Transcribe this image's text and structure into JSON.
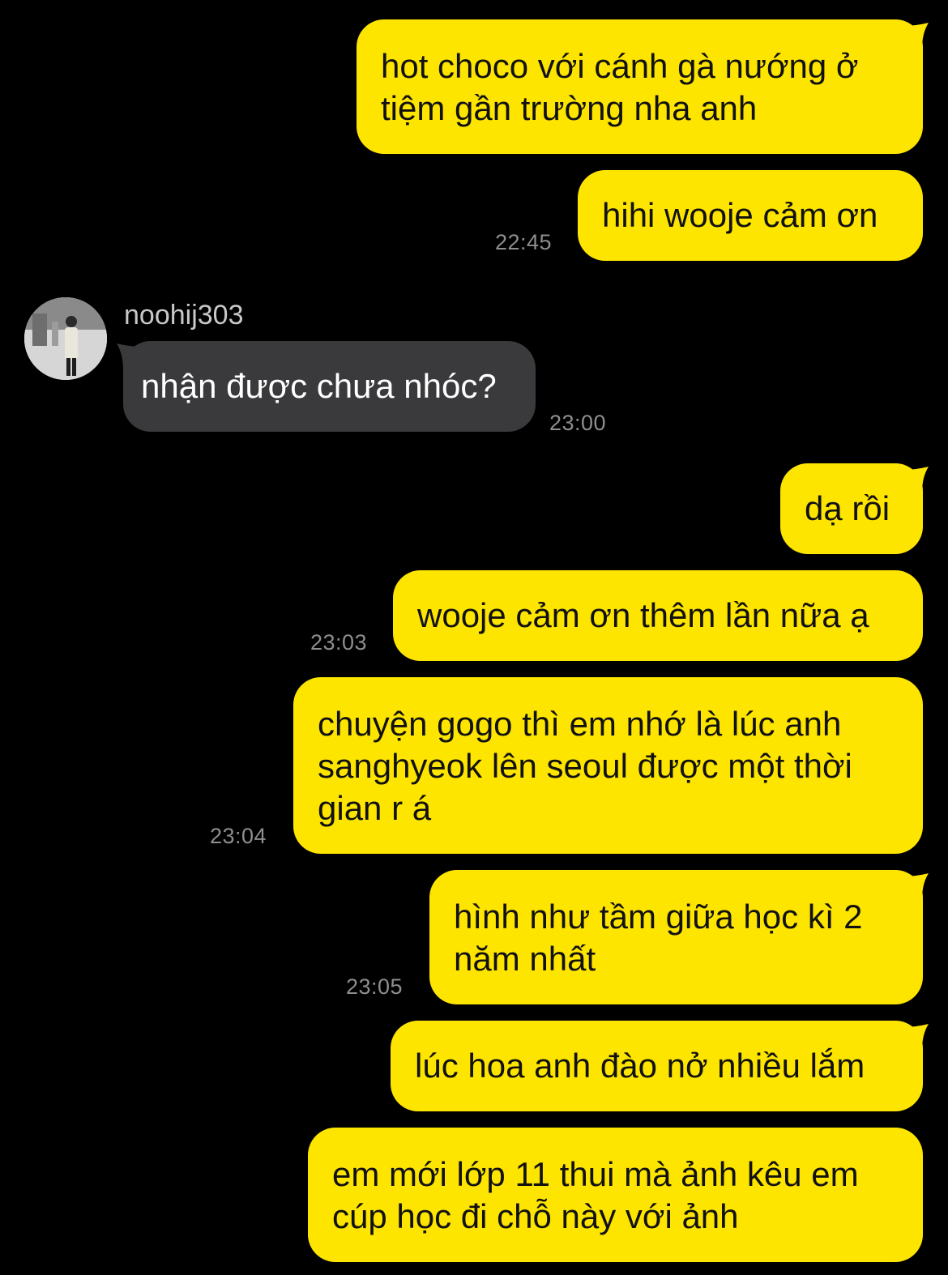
{
  "messages": [
    {
      "text": "hot choco với cánh gà nướng ở\ntiệm gần trường nha anh"
    },
    {
      "text": "hihi wooje cảm ơn",
      "time": "22:45"
    },
    {
      "sender": "noohij303",
      "text": "nhận được chưa nhóc?",
      "time": "23:00"
    },
    {
      "text": "dạ rồi"
    },
    {
      "text": "wooje cảm ơn thêm lần nữa ạ",
      "time": "23:03"
    },
    {
      "text": "chuyện gogo thì em nhớ là lúc anh\nsanghyeok lên seoul được một thời\ngian r á",
      "time": "23:04"
    },
    {
      "text": "hình như tầm giữa học kì 2\nnăm nhất",
      "time": "23:05"
    },
    {
      "text": "lúc hoa anh đào nở nhiều lắm"
    },
    {
      "text": "em mới lớp 11 thui mà ảnh kêu em\ncúp học đi chỗ này với ảnh"
    }
  ],
  "colors": {
    "background": "#000000",
    "outgoing_bubble": "#FEE500",
    "incoming_bubble": "#3a3a3c",
    "timestamp": "#8e8e8e"
  }
}
